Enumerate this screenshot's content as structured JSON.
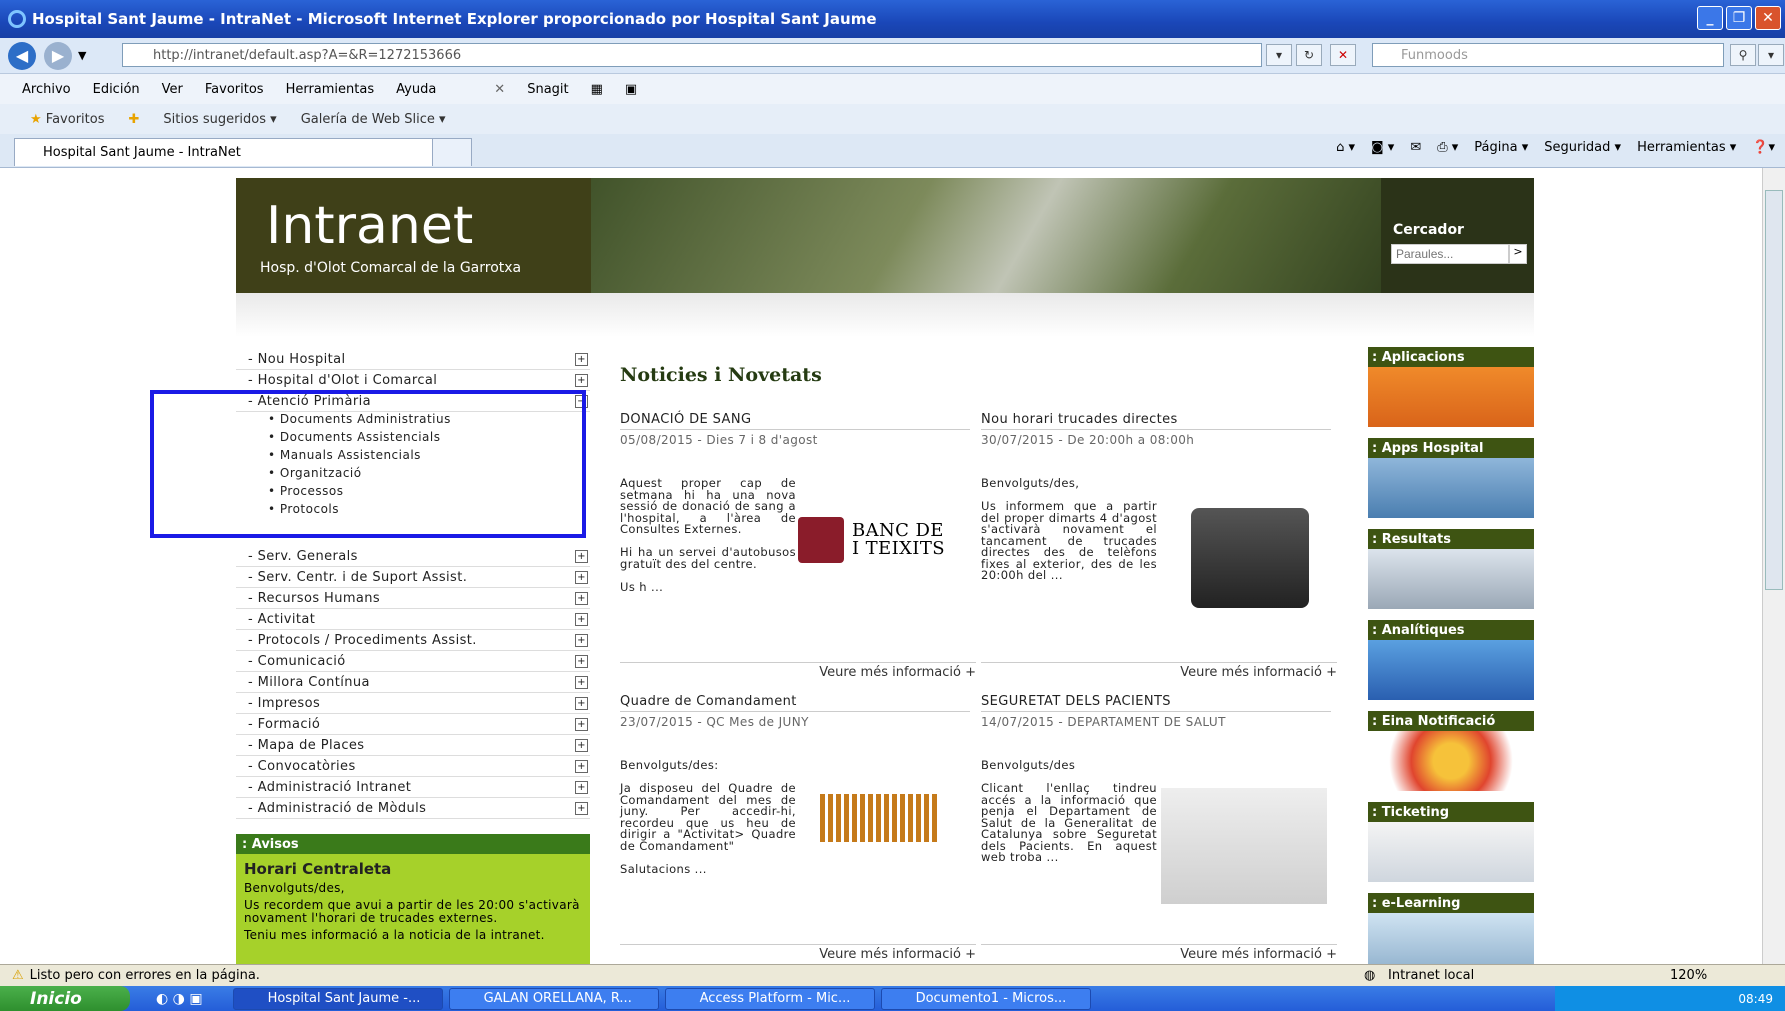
{
  "window": {
    "title": "Hospital Sant Jaume - IntraNet - Microsoft Internet Explorer proporcionado por Hospital Sant Jaume"
  },
  "address": {
    "url": "http://intranet/default.asp?A=&R=1272153666",
    "search_placeholder": "Funmoods"
  },
  "menu": [
    "Archivo",
    "Edición",
    "Ver",
    "Favoritos",
    "Herramientas",
    "Ayuda"
  ],
  "snagit": "Snagit",
  "favbar": {
    "favoritos": "Favoritos",
    "sitios": "Sitios sugeridos ▾",
    "galeria": "Galería de Web Slice ▾"
  },
  "tab": {
    "title": "Hospital Sant Jaume - IntraNet"
  },
  "cmdbar": {
    "pagina": "Página ▾",
    "seguridad": "Seguridad ▾",
    "herramientas": "Herramientas ▾"
  },
  "banner": {
    "title": "Intranet",
    "subtitle": "Hosp. d'Olot Comarcal de la Garrotxa",
    "search_label": "Cercador",
    "search_placeholder": "Paraules...",
    "search_btn": ">"
  },
  "nav": [
    {
      "label": "- Nou Hospital",
      "sign": "+"
    },
    {
      "label": "- Hospital d'Olot i Comarcal",
      "sign": "+"
    },
    {
      "label": "- Atenció Primària",
      "sign": "−"
    }
  ],
  "subnav": [
    "• Documents Administratius",
    "• Documents Assistencials",
    "• Manuals Assistencials",
    "• Organització",
    "• Processos",
    "• Protocols"
  ],
  "nav2": [
    {
      "label": "- Serv. Generals",
      "sign": "+"
    },
    {
      "label": "- Serv. Centr. i de Suport Assist.",
      "sign": "+"
    },
    {
      "label": "- Recursos Humans",
      "sign": "+"
    },
    {
      "label": "- Activitat",
      "sign": "+"
    },
    {
      "label": "- Protocols / Procediments Assist.",
      "sign": "+"
    },
    {
      "label": "- Comunicació",
      "sign": "+"
    },
    {
      "label": "- Millora Contínua",
      "sign": "+"
    },
    {
      "label": "- Impresos",
      "sign": "+"
    },
    {
      "label": "- Formació",
      "sign": "+"
    },
    {
      "label": "- Mapa de Places",
      "sign": "+"
    },
    {
      "label": "- Convocatòries",
      "sign": "+"
    },
    {
      "label": "- Administració Intranet",
      "sign": "+"
    },
    {
      "label": "- Administració de Mòduls",
      "sign": "+"
    }
  ],
  "avisos": {
    "header": ": Avisos",
    "title": "Horari Centraleta",
    "p1": "Benvolguts/des,",
    "p2": "Us recordem que avui a partir de les 20:00 s'activarà novament l'horari de trucades externes.",
    "p3": "Teniu mes informació a la noticia de la intranet."
  },
  "main": {
    "title": "Noticies i Novetats",
    "more": "Veure més informació +"
  },
  "news": [
    {
      "title": "DONACIÓ DE SANG",
      "date": "05/08/2015 - Dies 7 i 8 d'agost",
      "text": "Aquest proper cap de setmana hi ha una nova sessió de donació de sang a l'hospital, a l'àrea de Consultes Externes.",
      "text2": "Hi ha un servei d'autobusos gratuït des del centre.",
      "text3": "Us h ...",
      "logo": "BANC DE I TEIXITS"
    },
    {
      "title": "Nou horari trucades directes",
      "date": "30/07/2015 - De 20:00h a 08:00h",
      "text": "Benvolguts/des,",
      "text2": "Us informem que a partir del proper dimarts 4 d'agost s'activarà novament el tancament de trucades directes des de telèfons fixes al exterior, des de les 20:00h del ..."
    },
    {
      "title": "Quadre de Comandament",
      "date": "23/07/2015 - QC Mes de JUNY",
      "text": "Benvolguts/des:",
      "text2": "Ja disposeu del Quadre de Comandament del mes de juny. Per accedir-hi, recordeu que us heu de dirigir a \"Activitat> Quadre de Comandament\"",
      "text3": "Salutacions ..."
    },
    {
      "title": "SEGURETAT DELS PACIENTS",
      "date": "14/07/2015 - DEPARTAMENT DE SALUT",
      "text": "Benvolguts/des",
      "text2": "Clicant l'enllaç tindreu accés a la informació que penja el Departament de Salut de la Generalitat de Catalunya sobre Seguretat dels Pacients. En aquest web troba ..."
    }
  ],
  "apps": [
    ": Aplicacions",
    ": Apps Hospital",
    ": Resultats",
    ": Analítiques",
    ": Eina Notificació",
    ": Ticketing",
    ": e-Learning"
  ],
  "status": {
    "text": "Listo pero con errores en la página.",
    "zone": "Intranet local",
    "zoom": "120%"
  },
  "taskbar": {
    "start": "Inicio",
    "tasks": [
      "Hospital Sant Jaume -...",
      "GALAN ORELLANA, R...",
      "Access Platform - Mic...",
      "Documento1 - Micros..."
    ],
    "clock": "08:49"
  },
  "colors": {
    "accent": "#3e5412",
    "highlight_box": "#1a1ae6",
    "avisos_bg": "#a6d12a"
  }
}
